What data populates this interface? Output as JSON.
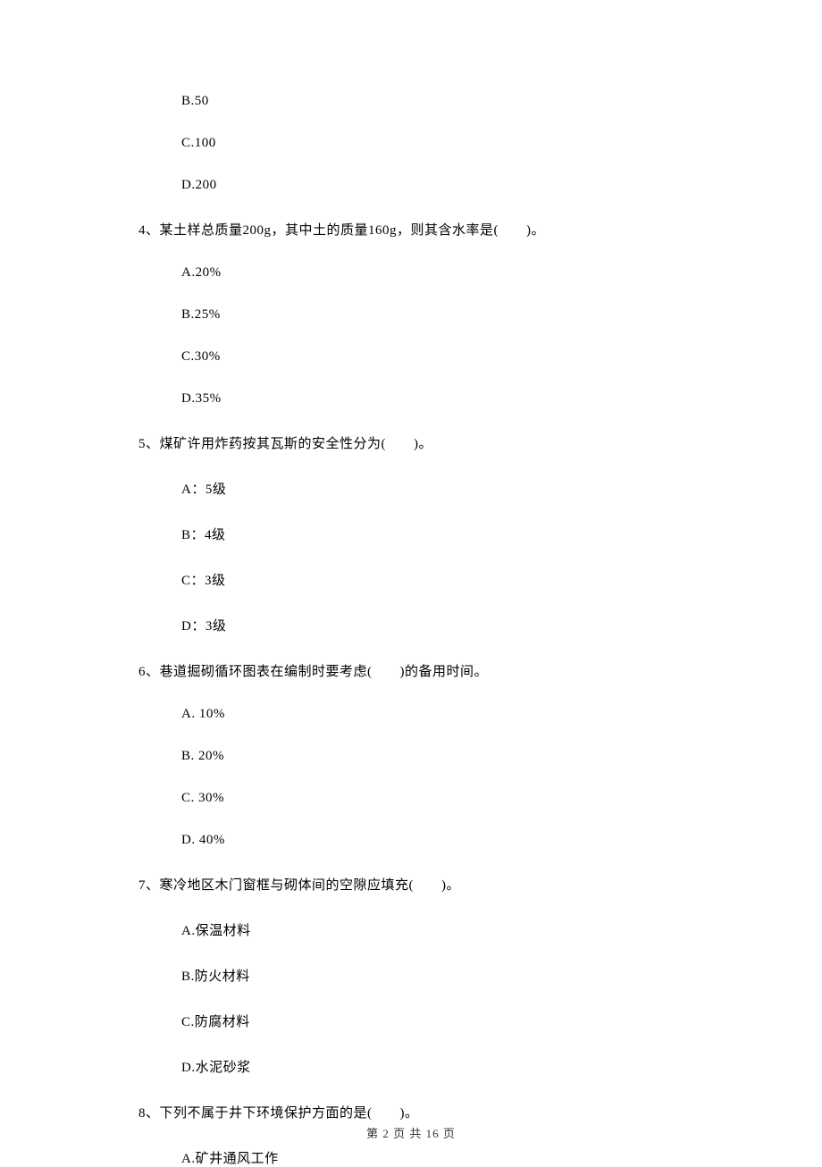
{
  "options_leading": [
    {
      "label": "B.50"
    },
    {
      "label": "C.100"
    },
    {
      "label": "D.200"
    }
  ],
  "questions": [
    {
      "number": "4、",
      "text": "某土样总质量200g，其中土的质量160g，则其含水率是(　　)。",
      "options": [
        {
          "label": "A.20%"
        },
        {
          "label": "B.25%"
        },
        {
          "label": "C.30%"
        },
        {
          "label": "D.35%"
        }
      ]
    },
    {
      "number": "5、",
      "text": "煤矿许用炸药按其瓦斯的安全性分为(　　)。",
      "options": [
        {
          "label": "A：5级"
        },
        {
          "label": "B：4级"
        },
        {
          "label": "C：3级"
        },
        {
          "label": "D：3级"
        }
      ]
    },
    {
      "number": "6、",
      "text": "巷道掘砌循环图表在编制时要考虑(　　)的备用时间。",
      "options": [
        {
          "label": "A. 10%"
        },
        {
          "label": "B. 20%"
        },
        {
          "label": "C. 30%"
        },
        {
          "label": "D. 40%"
        }
      ]
    },
    {
      "number": "7、",
      "text": "寒冷地区木门窗框与砌体间的空隙应填充(　　)。",
      "options": [
        {
          "label": "A.保温材料"
        },
        {
          "label": "B.防火材料"
        },
        {
          "label": "C.防腐材料"
        },
        {
          "label": "D.水泥砂浆"
        }
      ]
    },
    {
      "number": "8、",
      "text": "下列不属于井下环境保护方面的是(　　)。",
      "options": [
        {
          "label": "A.矿井通风工作"
        }
      ]
    }
  ],
  "footer": "第 2 页 共 16 页"
}
